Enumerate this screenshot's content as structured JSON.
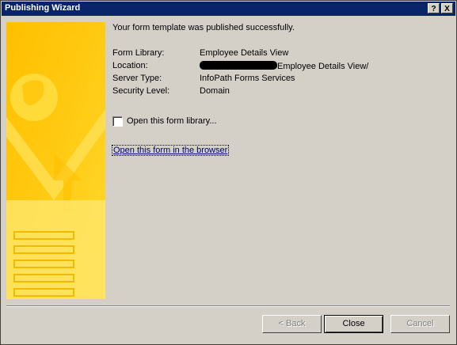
{
  "window": {
    "title": "Publishing Wizard",
    "help_glyph": "?",
    "close_glyph": "X"
  },
  "content": {
    "message": "Your form template was published successfully.",
    "fields": [
      {
        "label": "Form Library:",
        "value": "Employee Details View"
      },
      {
        "label": "Location:",
        "value": "Employee Details View/"
      },
      {
        "label": "Server Type:",
        "value": "InfoPath Forms Services"
      },
      {
        "label": "Security Level:",
        "value": "Domain"
      }
    ],
    "checkbox_label": "Open this form library...",
    "checkbox_checked": false,
    "link_text": "Open this form in the browser"
  },
  "buttons": {
    "back": "< Back",
    "close": "Close",
    "cancel": "Cancel"
  },
  "colors": {
    "titlebar": "#0a246a",
    "dialog_bg": "#d4d0c8",
    "link": "#000080",
    "banner_yellow": "#ffd200"
  }
}
